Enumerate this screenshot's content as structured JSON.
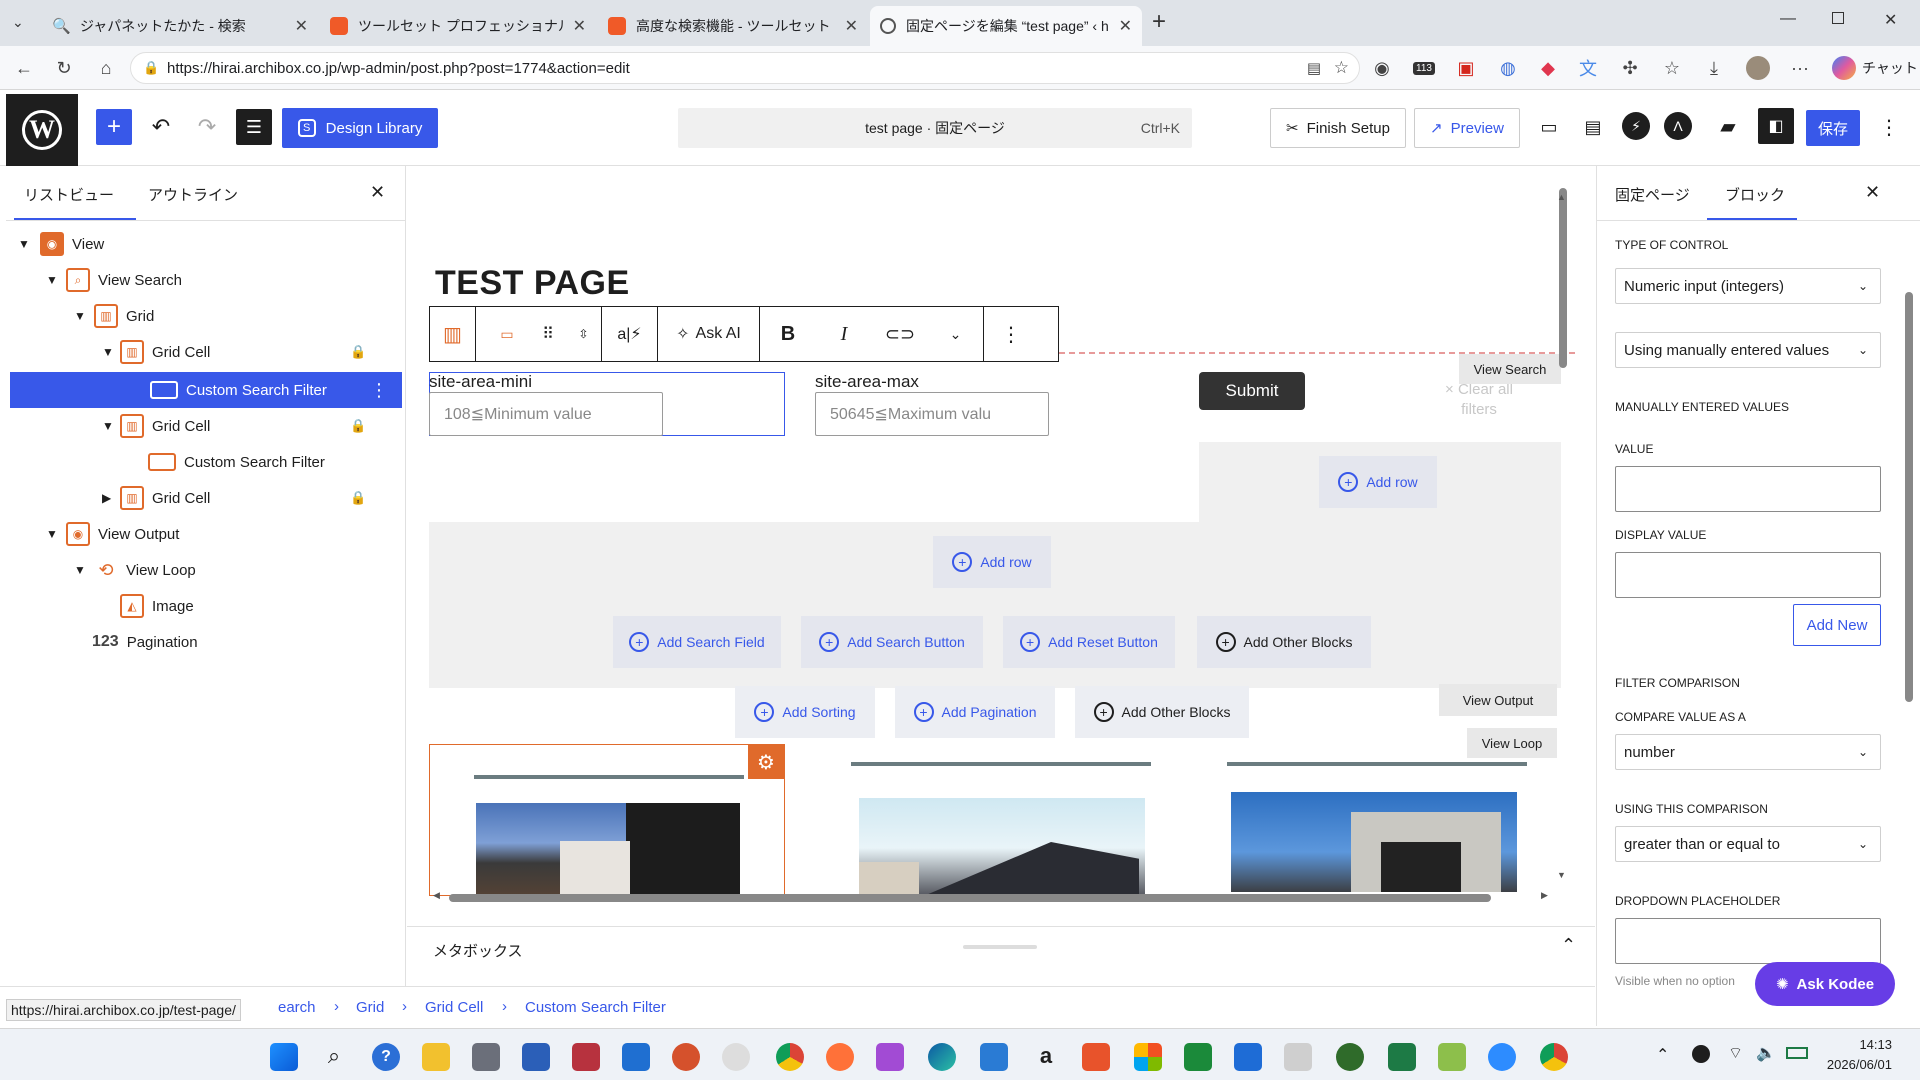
{
  "browser": {
    "tabs": [
      {
        "title": "ジャパネットたかた - 検索",
        "favicon_color": "#4a76c9"
      },
      {
        "title": "ツールセット プロフェッショナルサポート -",
        "favicon_color": "#f05a28"
      },
      {
        "title": "高度な検索機能 - ツールセット",
        "favicon_color": "#f05a28"
      },
      {
        "title": "固定ページを編集 “test page” ‹ hirai",
        "favicon_color": "#555555"
      }
    ],
    "url": "https://hirai.archibox.co.jp/wp-admin/post.php?post=1774&action=edit",
    "copilot_label": "チャット",
    "badge": "113"
  },
  "header": {
    "design_library": "Design Library",
    "doc_title": "test page · 固定ページ",
    "shortcut": "Ctrl+K",
    "finish_setup": "Finish Setup",
    "preview": "Preview",
    "save": "保存",
    "accent": "#3858e9"
  },
  "list_view": {
    "tab_list": "リストビュー",
    "tab_outline": "アウトライン",
    "items": [
      {
        "label": "View",
        "icon": "view-icon"
      },
      {
        "label": "View Search",
        "icon": "search-icon"
      },
      {
        "label": "Grid",
        "icon": "grid-icon"
      },
      {
        "label": "Grid Cell",
        "icon": "grid-icon"
      },
      {
        "label": "Custom Search Filter",
        "icon": "filter-icon"
      },
      {
        "label": "Grid Cell",
        "icon": "grid-icon"
      },
      {
        "label": "Custom Search Filter",
        "icon": "filter-icon"
      },
      {
        "label": "Grid Cell",
        "icon": "grid-icon"
      },
      {
        "label": "View Output",
        "icon": "eye-icon"
      },
      {
        "label": "View Loop",
        "icon": "loop-icon"
      },
      {
        "label": "Image",
        "icon": "image-icon"
      },
      {
        "label": "Pagination",
        "icon": "pagination-icon"
      }
    ],
    "pagination_icon_text": "123"
  },
  "canvas": {
    "page_title": "TEST PAGE",
    "block_toolbar": {
      "ask_ai": "Ask AI"
    },
    "field_min_label": "site-area-mini",
    "field_min_placeholder": "108≦Minimum value",
    "field_max_label": "site-area-max",
    "field_max_placeholder": "50645≦Maximum valu",
    "submit": "Submit",
    "clear_filters": "× Clear all filters",
    "view_search_label": "View Search",
    "add_row": "Add row",
    "add_search_field": "Add Search Field",
    "add_search_button": "Add Search Button",
    "add_reset_button": "Add Reset Button",
    "add_other_blocks": "Add Other Blocks",
    "view_output_label": "View Output",
    "add_sorting": "Add Sorting",
    "add_pagination": "Add Pagination",
    "view_loop_label": "View Loop",
    "metabox": "メタボックス"
  },
  "breadcrumb": {
    "items": [
      "earch",
      "Grid",
      "Grid Cell",
      "Custom Search Filter"
    ],
    "status_url": "https://hirai.archibox.co.jp/test-page/"
  },
  "right_panel": {
    "tab_page": "固定ページ",
    "tab_block": "ブロック",
    "type_of_control": "TYPE OF CONTROL",
    "control_value": "Numeric input (integers)",
    "values_source": "Using manually entered values",
    "manually_entered": "MANUALLY ENTERED VALUES",
    "value_label": "VALUE",
    "display_value_label": "DISPLAY VALUE",
    "add_new": "Add New",
    "filter_comparison": "FILTER COMPARISON",
    "compare_as": "COMPARE VALUE AS A",
    "compare_as_value": "number",
    "using_comparison": "USING THIS COMPARISON",
    "comparison_value": "greater than or equal to",
    "dropdown_placeholder": "DROPDOWN PLACEHOLDER",
    "visible_hint": "Visible when no option",
    "ask_kodee": "Ask Kodee"
  },
  "taskbar": {
    "time": "14:13",
    "date": "2026/06/01"
  }
}
